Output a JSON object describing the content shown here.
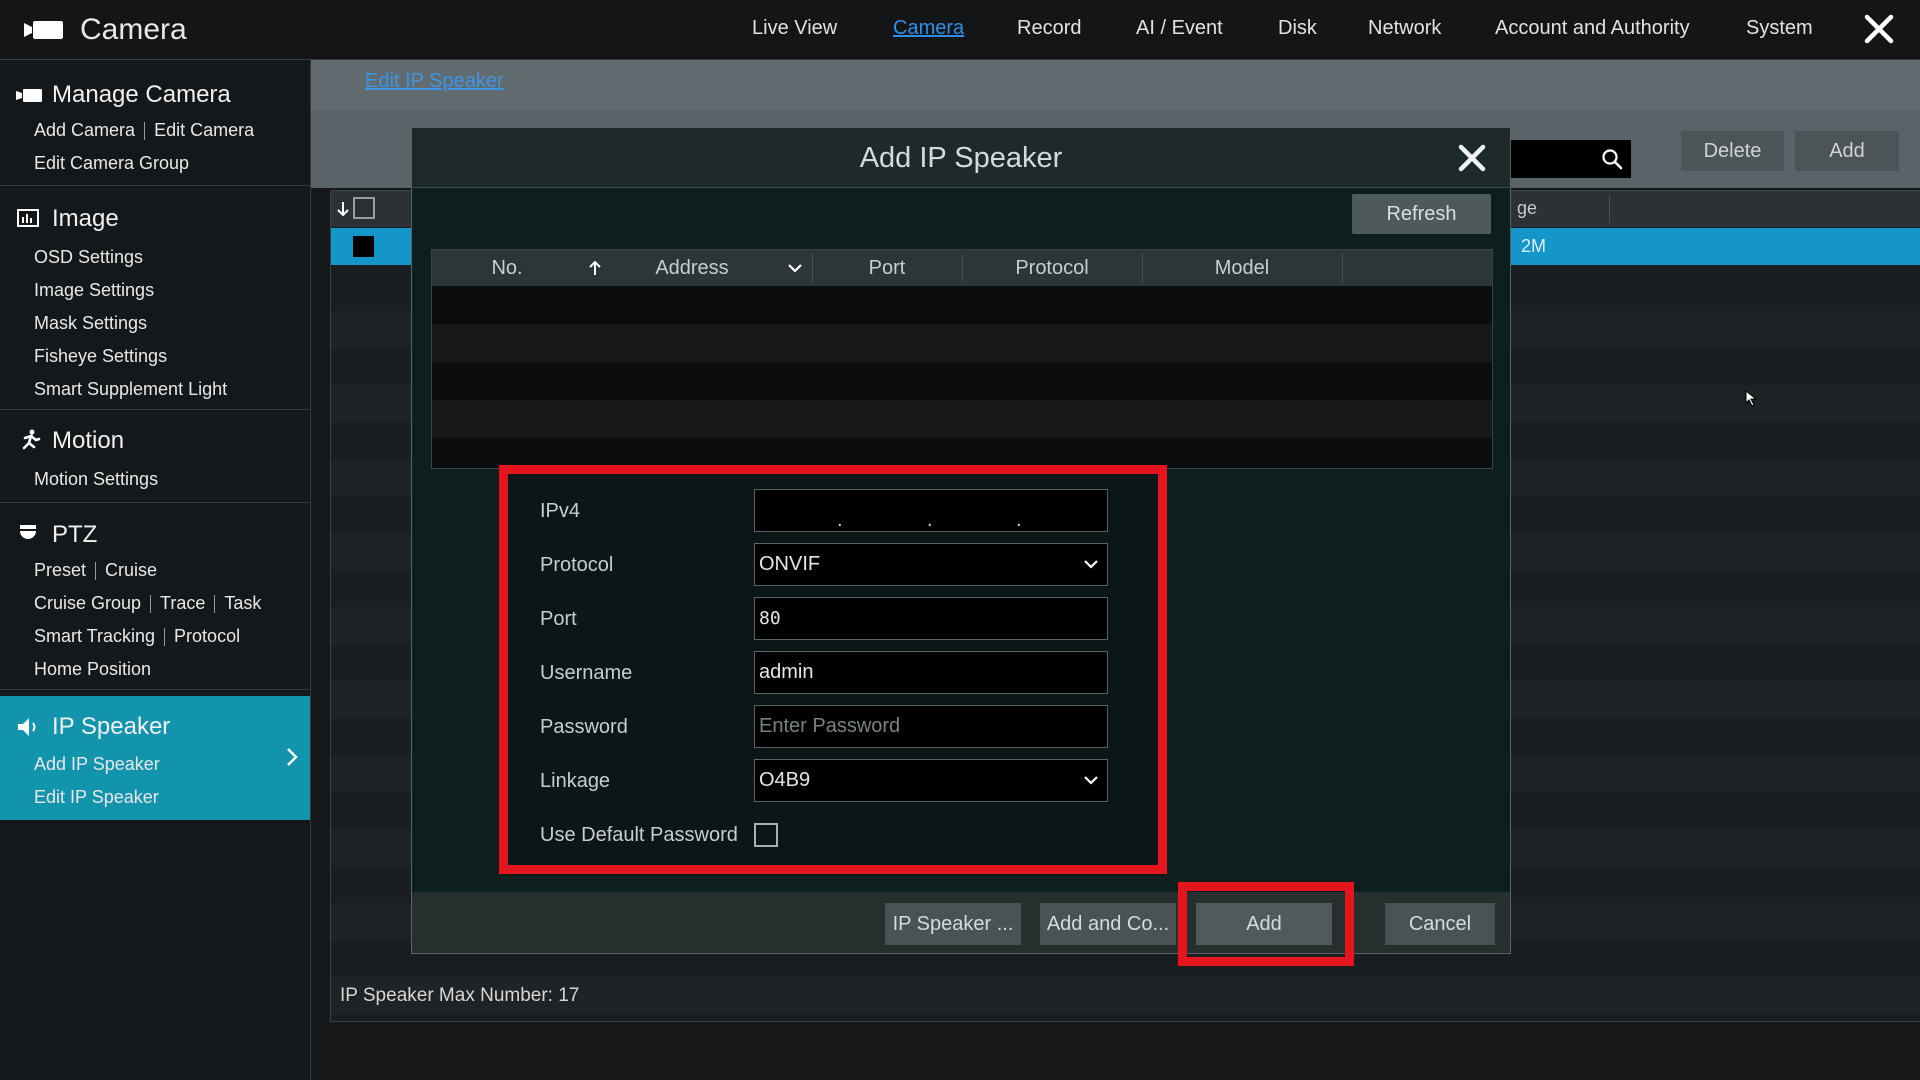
{
  "app": {
    "title": "Camera"
  },
  "nav": [
    "Live View",
    "Camera",
    "Record",
    "AI / Event",
    "Disk",
    "Network",
    "Account and Authority",
    "System"
  ],
  "nav_active": "Camera",
  "sidebar": {
    "manage_camera": {
      "title": "Manage Camera",
      "items": [
        "Add Camera",
        "Edit Camera",
        "Edit Camera Group"
      ]
    },
    "image": {
      "title": "Image",
      "items": [
        "OSD Settings",
        "Image Settings",
        "Mask Settings",
        "Fisheye Settings",
        "Smart Supplement Light"
      ]
    },
    "motion": {
      "title": "Motion",
      "items": [
        "Motion Settings"
      ]
    },
    "ptz": {
      "title": "PTZ",
      "items": [
        "Preset",
        "Cruise",
        "Cruise Group",
        "Trace",
        "Task",
        "Smart Tracking",
        "Protocol",
        "Home Position"
      ]
    },
    "ip_speaker": {
      "title": "IP Speaker",
      "items": [
        "Add IP Speaker",
        "Edit IP Speaker"
      ]
    }
  },
  "main": {
    "breadcrumb": "Edit IP Speaker",
    "delete_label": "Delete",
    "add_label": "Add",
    "partial_header": "ge",
    "partial_cell": "2M",
    "max_number": "IP Speaker Max Number: 17"
  },
  "modal": {
    "title": "Add IP Speaker",
    "refresh_label": "Refresh",
    "columns": [
      "No.",
      "Address",
      "Port",
      "Protocol",
      "Model"
    ],
    "form": {
      "ipv4_label": "IPv4",
      "protocol_label": "Protocol",
      "protocol_value": "ONVIF",
      "port_label": "Port",
      "port_value": "80",
      "username_label": "Username",
      "username_value": "admin",
      "password_label": "Password",
      "password_placeholder": "Enter Password",
      "linkage_label": "Linkage",
      "linkage_value": "O4B9",
      "default_password_label": "Use Default Password",
      "default_password_checked": false
    },
    "buttons": [
      "IP Speaker ...",
      "Add and Co...",
      "Add",
      "Cancel"
    ]
  },
  "colors": {
    "accent": "#1394ad",
    "highlight": "#e6141c",
    "link": "#2f8fe8"
  }
}
